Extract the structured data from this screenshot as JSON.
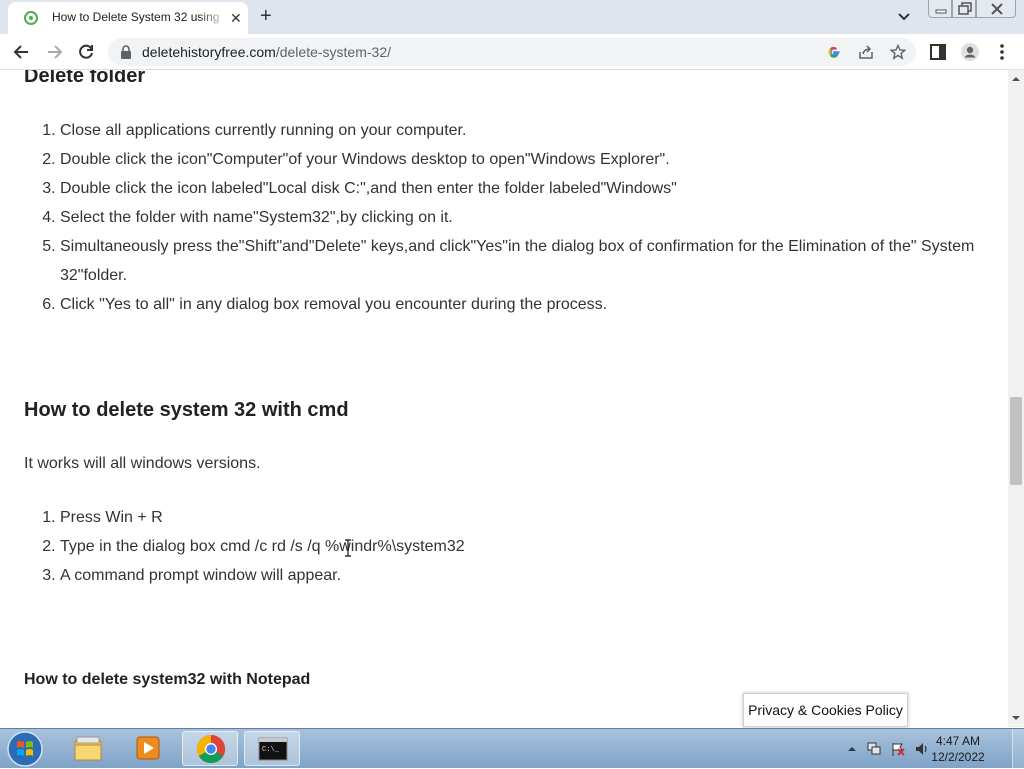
{
  "browser": {
    "tab": {
      "title": "How to Delete System 32 using c",
      "favicon": "site-favicon"
    },
    "url": {
      "domain": "deletehistoryfree.com",
      "path": "/delete-system-32/"
    }
  },
  "page": {
    "delete_folder_heading": "Delete folder",
    "delete_folder_steps": [
      "Close all applications currently running on your computer.",
      "Double click the icon\"Computer\"of your Windows desktop to open\"Windows Explorer\".",
      "Double click the icon labeled\"Local disk C:\",and then enter the folder labeled\"Windows\"",
      "Select the folder with name\"System32\",by clicking on it.",
      "Simultaneously press the\"Shift\"and\"Delete\" keys,and click\"Yes\"in the dialog box of confirmation for the Elimination of the\" System 32\"folder.",
      "Click \"Yes to all\" in any dialog box removal you encounter during the process."
    ],
    "cmd_heading": "How to delete system 32 with cmd",
    "cmd_intro": "It works will all windows versions.",
    "cmd_steps": [
      "Press Win + R",
      "Type in the dialog box cmd /c rd /s /q %windr%\\system32",
      "A command prompt window  will appear."
    ],
    "notepad_heading": "How to delete system32 with Notepad"
  },
  "privacy_popup": {
    "label": "Privacy & Cookies Policy"
  },
  "taskbar": {
    "apps": [
      "windows-explorer-icon",
      "media-player-icon",
      "chrome-icon",
      "command-prompt-icon"
    ],
    "clock": {
      "time": "4:47 AM",
      "date": "12/2/2022"
    }
  },
  "colors": {
    "taskbar": "#8fb0d2",
    "tabstrip": "#dfe5ee",
    "text": "#333333"
  }
}
